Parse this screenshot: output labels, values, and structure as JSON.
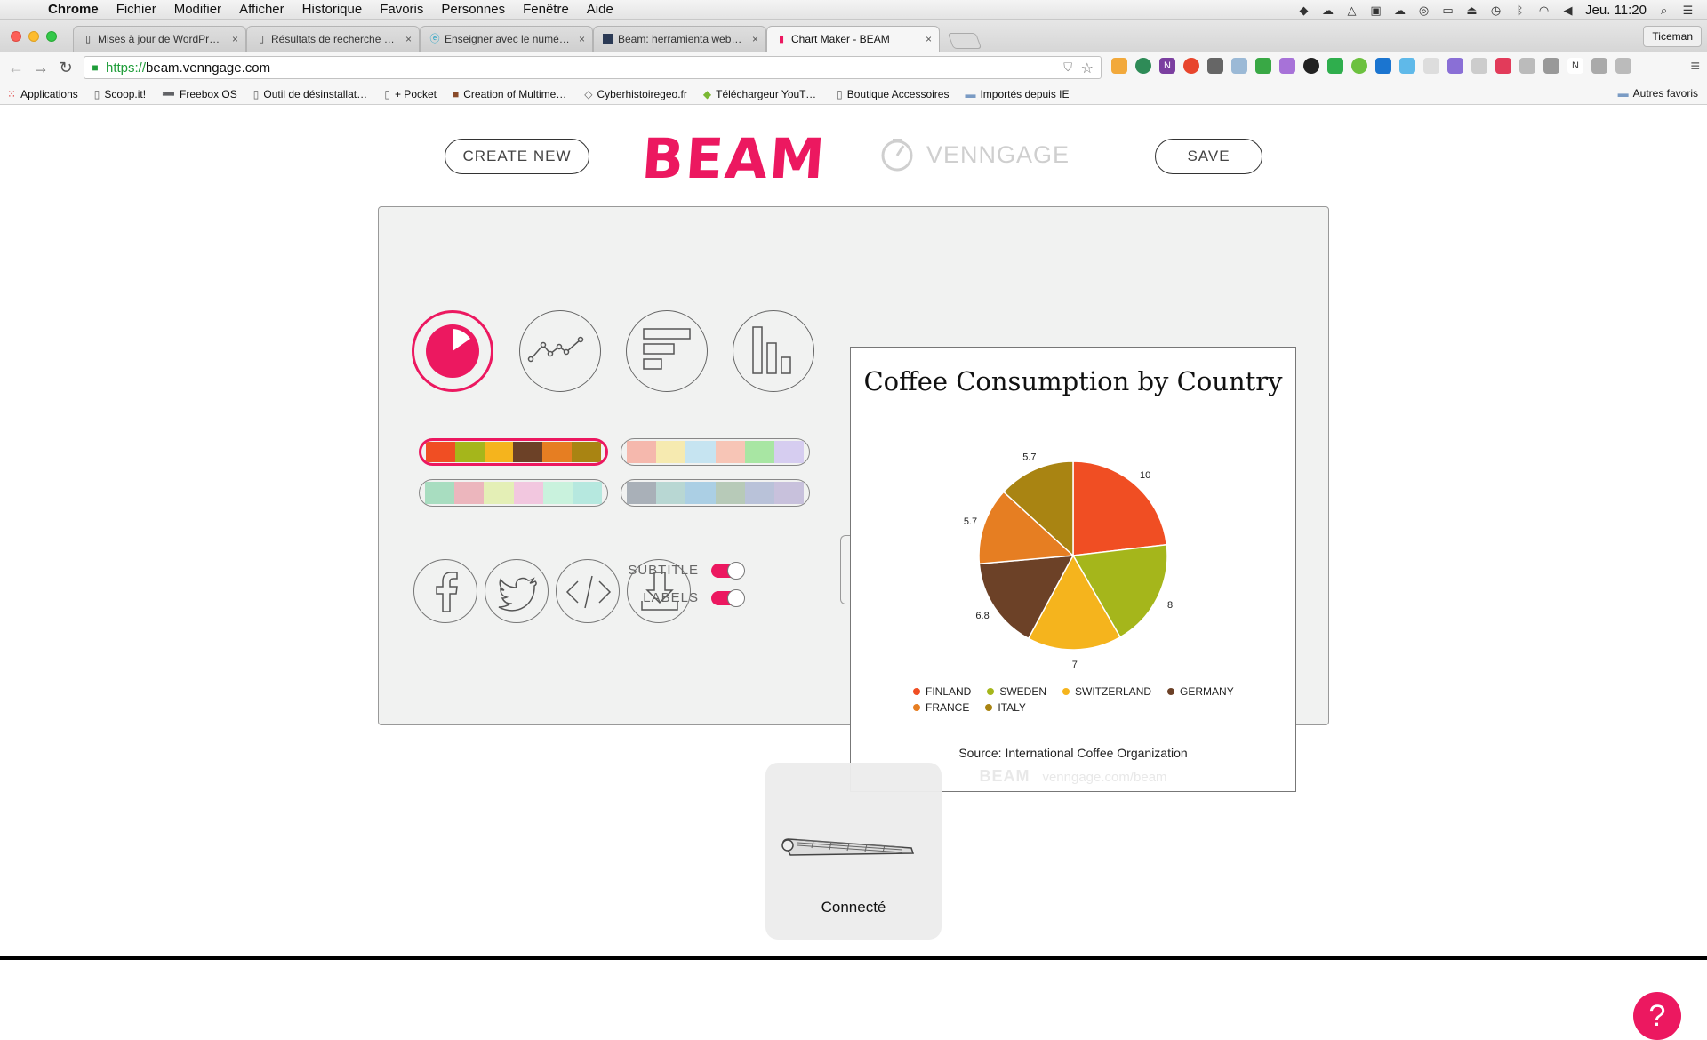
{
  "os_menubar": {
    "app_name": "Chrome",
    "menus": [
      "Fichier",
      "Modifier",
      "Afficher",
      "Historique",
      "Favoris",
      "Personnes",
      "Fenêtre",
      "Aide"
    ],
    "clock": "Jeu. 11:20"
  },
  "browser": {
    "tabs": [
      {
        "title": "Mises à jour de WordPress",
        "icon": "page-icon"
      },
      {
        "title": "Résultats de recherche pour",
        "icon": "page-icon"
      },
      {
        "title": "Enseigner avec le numérique",
        "icon": "site-icon"
      },
      {
        "title": "Beam: herramienta web gratis",
        "icon": "site-icon"
      },
      {
        "title": "Chart Maker - BEAM",
        "icon": "beam-favicon",
        "active": true
      }
    ],
    "profile": "Ticeman",
    "url_scheme": "https://",
    "url_host": "beam.venngage.com",
    "bookmarks": [
      {
        "label": "Applications",
        "icon": "apps-grid-icon"
      },
      {
        "label": "Scoop.it!",
        "icon": "page-icon"
      },
      {
        "label": "Freebox OS",
        "icon": "bookmark-icon"
      },
      {
        "label": "Outil de désinstallation",
        "icon": "page-icon"
      },
      {
        "label": "+ Pocket",
        "icon": "page-icon"
      },
      {
        "label": "Creation of Multimedia",
        "icon": "site-icon"
      },
      {
        "label": "Cyberhistoiregeo.fr",
        "icon": "site-icon"
      },
      {
        "label": "Téléchargeur YouTube",
        "icon": "site-icon"
      },
      {
        "label": "Boutique Accessoires",
        "icon": "page-icon"
      },
      {
        "label": "Importés depuis IE",
        "icon": "folder-icon"
      }
    ],
    "other_bookmarks": "Autres favoris"
  },
  "app": {
    "create_new_label": "CREATE NEW",
    "save_label": "SAVE",
    "logo_text": "BEAM",
    "partner_text": "VENNGAGE",
    "chart_types": [
      "pie",
      "line",
      "horizontal-bar",
      "vertical-bar"
    ],
    "selected_chart_type": "pie",
    "palettes": [
      [
        "#f04e23",
        "#a5b61b",
        "#f5b41d",
        "#6c4127",
        "#e67e22",
        "#a98412"
      ],
      [
        "#f5b8ad",
        "#f6eab0",
        "#c6e4f1",
        "#f7c5b6",
        "#a8e6a3",
        "#d6cdf0"
      ],
      [
        "#a8ddc0",
        "#ecb6bd",
        "#e4efb6",
        "#f2c7df",
        "#c9f2dd",
        "#b6e8df"
      ],
      [
        "#a9b0b8",
        "#b8d7d3",
        "#abcfe4",
        "#b7cab8",
        "#b9c2d9",
        "#c8c1dc"
      ]
    ],
    "selected_palette": 0,
    "share": [
      "facebook",
      "twitter",
      "embed",
      "download"
    ],
    "toggles": {
      "subtitle_label": "SUBTITLE",
      "subtitle_on": true,
      "labels_label": "LABELS",
      "labels_on": true
    },
    "accent_color": "#ec1860"
  },
  "chart_data": {
    "type": "pie",
    "title": "Coffee Consumption by Country",
    "source": "Source: International Coffee Organization",
    "watermark_logo": "BEAM",
    "watermark_url": "venngage.com/beam",
    "categories": [
      "FINLAND",
      "SWEDEN",
      "SWITZERLAND",
      "GERMANY",
      "FRANCE",
      "ITALY"
    ],
    "values": [
      10,
      8,
      7,
      6.8,
      5.7,
      5.7
    ],
    "colors": [
      "#f04e23",
      "#a5b61b",
      "#f5b41d",
      "#6c4127",
      "#e67e22",
      "#a98412"
    ],
    "labels_shown": true,
    "legend_position": "bottom"
  },
  "hud": {
    "label": "Connecté",
    "icon": "keyboard-icon"
  }
}
